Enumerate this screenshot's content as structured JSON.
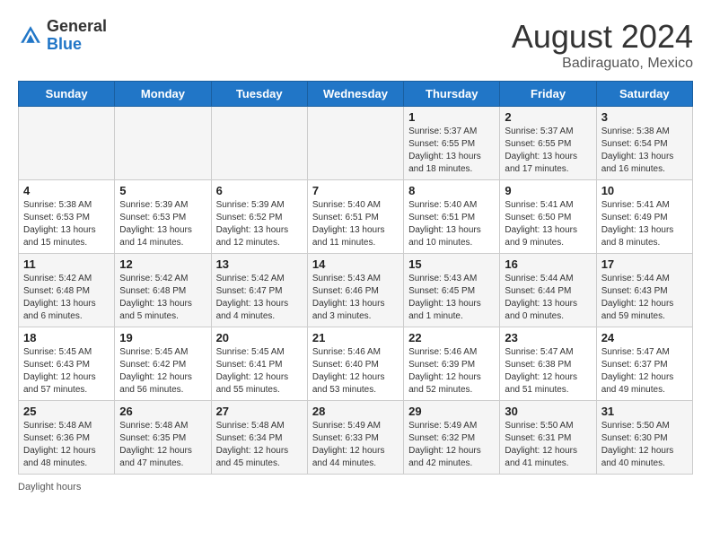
{
  "header": {
    "logo_general": "General",
    "logo_blue": "Blue",
    "month_year": "August 2024",
    "location": "Badiraguato, Mexico"
  },
  "days_of_week": [
    "Sunday",
    "Monday",
    "Tuesday",
    "Wednesday",
    "Thursday",
    "Friday",
    "Saturday"
  ],
  "weeks": [
    [
      {
        "day": "",
        "info": ""
      },
      {
        "day": "",
        "info": ""
      },
      {
        "day": "",
        "info": ""
      },
      {
        "day": "",
        "info": ""
      },
      {
        "day": "1",
        "info": "Sunrise: 5:37 AM\nSunset: 6:55 PM\nDaylight: 13 hours and 18 minutes."
      },
      {
        "day": "2",
        "info": "Sunrise: 5:37 AM\nSunset: 6:55 PM\nDaylight: 13 hours and 17 minutes."
      },
      {
        "day": "3",
        "info": "Sunrise: 5:38 AM\nSunset: 6:54 PM\nDaylight: 13 hours and 16 minutes."
      }
    ],
    [
      {
        "day": "4",
        "info": "Sunrise: 5:38 AM\nSunset: 6:53 PM\nDaylight: 13 hours and 15 minutes."
      },
      {
        "day": "5",
        "info": "Sunrise: 5:39 AM\nSunset: 6:53 PM\nDaylight: 13 hours and 14 minutes."
      },
      {
        "day": "6",
        "info": "Sunrise: 5:39 AM\nSunset: 6:52 PM\nDaylight: 13 hours and 12 minutes."
      },
      {
        "day": "7",
        "info": "Sunrise: 5:40 AM\nSunset: 6:51 PM\nDaylight: 13 hours and 11 minutes."
      },
      {
        "day": "8",
        "info": "Sunrise: 5:40 AM\nSunset: 6:51 PM\nDaylight: 13 hours and 10 minutes."
      },
      {
        "day": "9",
        "info": "Sunrise: 5:41 AM\nSunset: 6:50 PM\nDaylight: 13 hours and 9 minutes."
      },
      {
        "day": "10",
        "info": "Sunrise: 5:41 AM\nSunset: 6:49 PM\nDaylight: 13 hours and 8 minutes."
      }
    ],
    [
      {
        "day": "11",
        "info": "Sunrise: 5:42 AM\nSunset: 6:48 PM\nDaylight: 13 hours and 6 minutes."
      },
      {
        "day": "12",
        "info": "Sunrise: 5:42 AM\nSunset: 6:48 PM\nDaylight: 13 hours and 5 minutes."
      },
      {
        "day": "13",
        "info": "Sunrise: 5:42 AM\nSunset: 6:47 PM\nDaylight: 13 hours and 4 minutes."
      },
      {
        "day": "14",
        "info": "Sunrise: 5:43 AM\nSunset: 6:46 PM\nDaylight: 13 hours and 3 minutes."
      },
      {
        "day": "15",
        "info": "Sunrise: 5:43 AM\nSunset: 6:45 PM\nDaylight: 13 hours and 1 minute."
      },
      {
        "day": "16",
        "info": "Sunrise: 5:44 AM\nSunset: 6:44 PM\nDaylight: 13 hours and 0 minutes."
      },
      {
        "day": "17",
        "info": "Sunrise: 5:44 AM\nSunset: 6:43 PM\nDaylight: 12 hours and 59 minutes."
      }
    ],
    [
      {
        "day": "18",
        "info": "Sunrise: 5:45 AM\nSunset: 6:43 PM\nDaylight: 12 hours and 57 minutes."
      },
      {
        "day": "19",
        "info": "Sunrise: 5:45 AM\nSunset: 6:42 PM\nDaylight: 12 hours and 56 minutes."
      },
      {
        "day": "20",
        "info": "Sunrise: 5:45 AM\nSunset: 6:41 PM\nDaylight: 12 hours and 55 minutes."
      },
      {
        "day": "21",
        "info": "Sunrise: 5:46 AM\nSunset: 6:40 PM\nDaylight: 12 hours and 53 minutes."
      },
      {
        "day": "22",
        "info": "Sunrise: 5:46 AM\nSunset: 6:39 PM\nDaylight: 12 hours and 52 minutes."
      },
      {
        "day": "23",
        "info": "Sunrise: 5:47 AM\nSunset: 6:38 PM\nDaylight: 12 hours and 51 minutes."
      },
      {
        "day": "24",
        "info": "Sunrise: 5:47 AM\nSunset: 6:37 PM\nDaylight: 12 hours and 49 minutes."
      }
    ],
    [
      {
        "day": "25",
        "info": "Sunrise: 5:48 AM\nSunset: 6:36 PM\nDaylight: 12 hours and 48 minutes."
      },
      {
        "day": "26",
        "info": "Sunrise: 5:48 AM\nSunset: 6:35 PM\nDaylight: 12 hours and 47 minutes."
      },
      {
        "day": "27",
        "info": "Sunrise: 5:48 AM\nSunset: 6:34 PM\nDaylight: 12 hours and 45 minutes."
      },
      {
        "day": "28",
        "info": "Sunrise: 5:49 AM\nSunset: 6:33 PM\nDaylight: 12 hours and 44 minutes."
      },
      {
        "day": "29",
        "info": "Sunrise: 5:49 AM\nSunset: 6:32 PM\nDaylight: 12 hours and 42 minutes."
      },
      {
        "day": "30",
        "info": "Sunrise: 5:50 AM\nSunset: 6:31 PM\nDaylight: 12 hours and 41 minutes."
      },
      {
        "day": "31",
        "info": "Sunrise: 5:50 AM\nSunset: 6:30 PM\nDaylight: 12 hours and 40 minutes."
      }
    ]
  ],
  "footer": {
    "daylight_label": "Daylight hours"
  },
  "colors": {
    "header_bg": "#2176c7",
    "odd_row": "#f5f5f5",
    "even_row": "#ffffff"
  }
}
